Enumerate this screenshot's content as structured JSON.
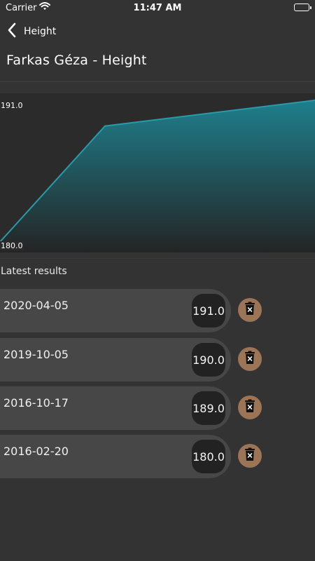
{
  "status_bar": {
    "carrier": "Carrier",
    "time": "11:47 AM"
  },
  "nav": {
    "back_label": "Height"
  },
  "page_title": "Farkas Géza - Height",
  "chart_data": {
    "type": "area",
    "x": [
      "2016-02-20",
      "2016-10-17",
      "2019-10-05",
      "2020-04-05"
    ],
    "values": [
      180.0,
      189.0,
      190.0,
      191.0
    ],
    "title": "",
    "xlabel": "",
    "ylabel": "",
    "ylim": [
      180.0,
      191.0
    ],
    "ytick_labels": [
      "191.0",
      "180.0"
    ],
    "grid": false,
    "colors": {
      "line": "#2a9aa8",
      "fill_top": "#1e7f8c",
      "fill_bottom": "#242424"
    }
  },
  "results": {
    "section_label": "Latest results",
    "items": [
      {
        "date": "2020-04-05",
        "value": "191.0"
      },
      {
        "date": "2019-10-05",
        "value": "190.0"
      },
      {
        "date": "2016-10-17",
        "value": "189.0"
      },
      {
        "date": "2016-02-20",
        "value": "180.0"
      }
    ]
  },
  "icons": {
    "back": "chevron-left-icon",
    "delete": "trash-icon",
    "wifi": "wifi-icon",
    "battery": "battery-icon"
  },
  "colors": {
    "background": "#333333",
    "card": "#474747",
    "badge": "#222222",
    "delete_button": "#9c7456"
  }
}
